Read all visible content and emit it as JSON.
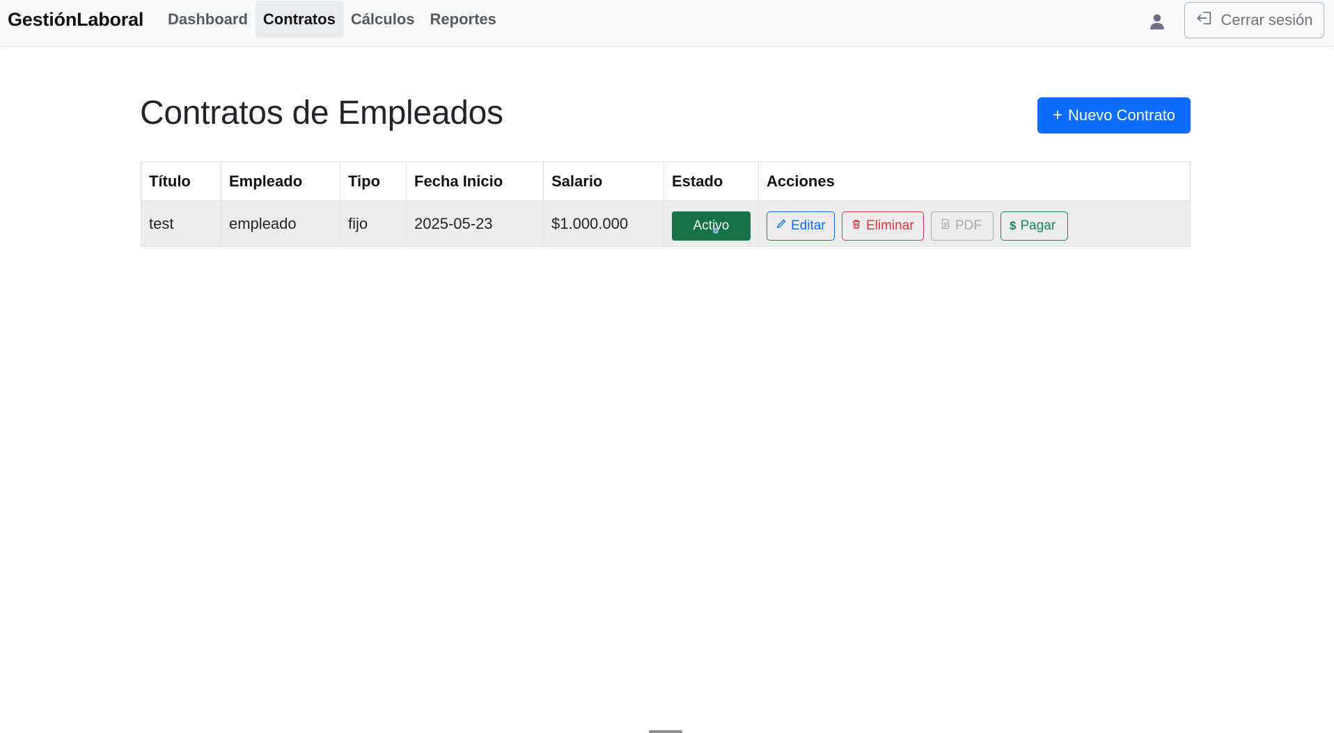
{
  "navbar": {
    "brand": "GestiónLaboral",
    "links": [
      {
        "label": "Dashboard"
      },
      {
        "label": "Contratos"
      },
      {
        "label": "Cálculos"
      },
      {
        "label": "Reportes"
      }
    ],
    "logout_label": "Cerrar sesión"
  },
  "main": {
    "title": "Contratos de Empleados",
    "new_button_label": "Nuevo Contrato",
    "new_button_icon": "+"
  },
  "table": {
    "headers": [
      "Título",
      "Empleado",
      "Tipo",
      "Fecha Inicio",
      "Salario",
      "Estado",
      "Acciones"
    ],
    "rows": [
      {
        "titulo": "test",
        "empleado": "empleado",
        "tipo": "fijo",
        "fecha_inicio": "2025-05-23",
        "salario": "$1.000.000",
        "estado": "Activo",
        "actions": {
          "edit": "Editar",
          "delete": "Eliminar",
          "pdf": "PDF",
          "pay": "Pagar"
        }
      }
    ]
  },
  "colors": {
    "primary": "#0d6efd",
    "success": "#157347",
    "danger": "#dc3545",
    "secondary": "#6c757d",
    "navbar_bg": "#f8f9fa"
  },
  "icons": {
    "user": "user-icon",
    "logout": "logout-icon",
    "edit": "pencil-icon",
    "delete": "trash-icon",
    "pdf": "file-icon",
    "pay": "dollar-icon"
  }
}
